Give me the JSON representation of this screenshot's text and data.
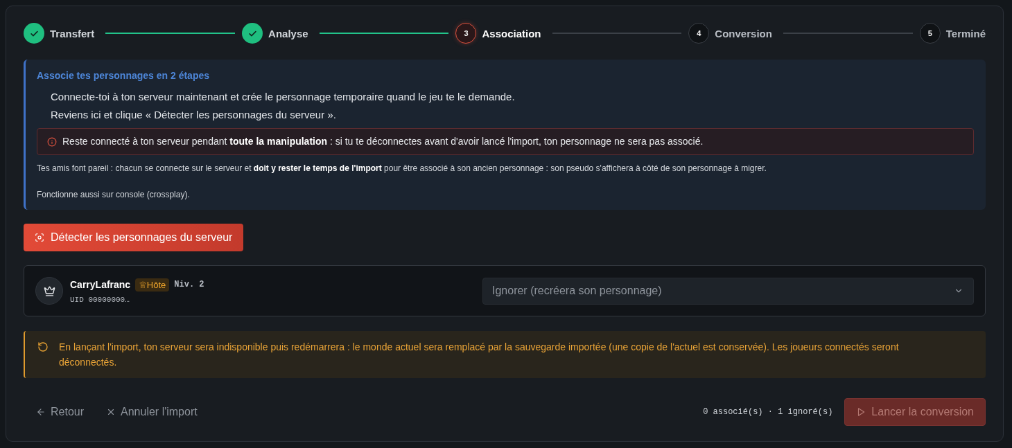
{
  "stepper": {
    "steps": [
      {
        "label": "Transfert",
        "completed": true,
        "current": false
      },
      {
        "label": "Analyse",
        "completed": true,
        "current": false
      },
      {
        "number": "3",
        "label": "Association",
        "completed": false,
        "current": true
      },
      {
        "number": "4",
        "label": "Conversion",
        "completed": false,
        "current": false
      },
      {
        "number": "5",
        "label": "Terminé",
        "completed": false,
        "current": false
      }
    ]
  },
  "instructions": {
    "title": "Associe tes personnages en 2 étapes",
    "steps": [
      "Connecte-toi à ton serveur maintenant et crée le personnage temporaire quand le jeu te le demande.",
      "Reviens ici et clique « Détecter les personnages du serveur »."
    ],
    "alert": "Reste connecté à ton serveur pendant **toute la manipulation** : si tu te déconnectes avant d'avoir lancé l'import, ton personnage ne sera pas associé.",
    "notes": [
      "Tes amis font pareil : chacun se connecte sur le serveur et **doit y rester le temps de l'import** pour être associé à son ancien personnage : son pseudo s'affichera à côté de son personnage à migrer.",
      "Fonctionne aussi sur console (crossplay)."
    ]
  },
  "detect_button": {
    "label": "Détecter les personnages du serveur"
  },
  "players": [
    {
      "name": "CarryLafranc",
      "badge": "♕Hôte",
      "level_label": "Niv. 2",
      "uid": "UID 00000000…",
      "action": {
        "value": "Ignorer (recréera son personnage)"
      }
    }
  ],
  "warning": "En lançant l'import, ton serveur sera indisponible puis redémarrera : le monde actuel sera remplacé par la sauvegarde importée (une copie de l'actuel est conservée). Les joueurs connectés seront déconnectés.",
  "footer": {
    "back": "Retour",
    "cancel": "Annuler l'import",
    "summary": "0 associé(s) · 1 ignoré(s)",
    "launch_button": {
      "label": "Lancer la conversion",
      "disabled": true
    }
  }
}
